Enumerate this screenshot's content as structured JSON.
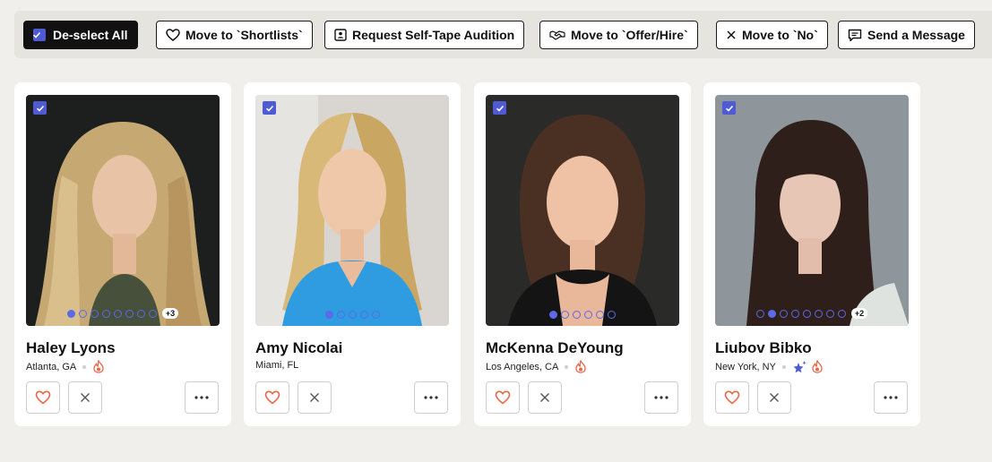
{
  "toolbar": {
    "deselect_label": "De-select All",
    "shortlist_label": "Move to `Shortlists`",
    "selftape_label": "Request Self-Tape Audition",
    "offer_label": "Move to `Offer/Hire`",
    "no_label": "Move to `No`",
    "message_label": "Send a Message"
  },
  "cards": [
    {
      "name": "Haley Lyons",
      "location": "Atlanta, GA",
      "photo_count_more": "+3",
      "badges": [
        "fire-icon"
      ]
    },
    {
      "name": "Amy Nicolai",
      "location": "Miami, FL",
      "photo_count_more": "",
      "badges": []
    },
    {
      "name": "McKenna DeYoung",
      "location": "Los Angeles, CA",
      "photo_count_more": "",
      "badges": [
        "fire-icon"
      ]
    },
    {
      "name": "Liubov Bibko",
      "location": "New York, NY",
      "photo_count_more": "+2",
      "badges": [
        "sparkle-star-icon",
        "fire-icon"
      ]
    }
  ],
  "colors": {
    "accent": "#4f5bd5",
    "heart": "#e8674a",
    "fire": "#e8674a"
  }
}
